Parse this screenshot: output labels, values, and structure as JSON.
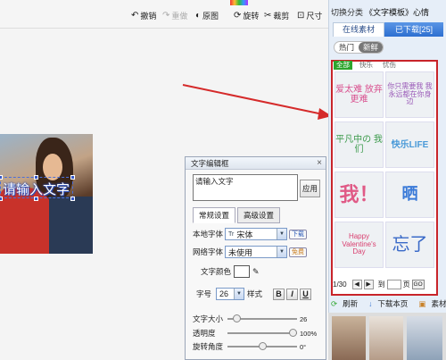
{
  "toolbar": {
    "undo": "撤销",
    "redo": "重做",
    "original": "原图",
    "rotate": "旋转",
    "crop": "裁剪",
    "size": "尺寸"
  },
  "canvas": {
    "text_preview": "请输入文字"
  },
  "right_panel": {
    "template_label": "切换分类",
    "template_value": "《文字模板》心情",
    "tab_online": "在线素材",
    "tab_downloaded": "已下载[25]",
    "sub_hot": "热门",
    "sub_new": "新鲜",
    "categories": [
      "全部",
      "快乐",
      "忧伤"
    ],
    "items": [
      {
        "text": "爱太难 放弃更难",
        "color": "#d9518f"
      },
      {
        "text": "你只需要我 我永远都在你身边",
        "color": "#9a5ab8"
      },
      {
        "text": "平凡中の 我们",
        "color": "#3a9a4a"
      },
      {
        "text": "快乐LIFE",
        "color": "#4a9ad8"
      },
      {
        "text": "我！",
        "color": "#e05a86"
      },
      {
        "text": "晒",
        "color": "#3a7ad8"
      },
      {
        "text": "Happy Valentine's Day",
        "color": "#d94070"
      },
      {
        "text": "忘了",
        "color": "#3a6ac8"
      }
    ],
    "pager": {
      "current": "1/30",
      "goto": "到",
      "page": "页",
      "go": "GO"
    },
    "bottom": {
      "refresh": "刷新",
      "download_page": "下载本页",
      "pack": "素材包"
    }
  },
  "dialog": {
    "title": "文字编辑框",
    "close": "×",
    "input_value": "请输入文字",
    "apply": "应用",
    "tab_normal": "常规设置",
    "tab_advanced": "高级设置",
    "local_font_label": "本地字体",
    "local_font_value": "宋体",
    "download_btn": "下载",
    "web_font_label": "网络字体",
    "web_font_value": "未使用",
    "free_btn": "免费",
    "color_label": "文字颜色",
    "size_label": "字号",
    "size_value": "26",
    "style_label": "样式",
    "bold": "B",
    "italic": "I",
    "underline": "U",
    "font_size_label": "文字大小",
    "font_size_value": "26",
    "opacity_label": "透明度",
    "opacity_value": "100%",
    "angle_label": "旋转角度",
    "angle_value": "0°"
  },
  "sliders": {
    "font_size": 0.08,
    "opacity": 1.0,
    "angle": 0.5
  },
  "colors": {
    "accent_blue": "#2d6fd0",
    "highlight_red": "#c8242a",
    "green": "#2ea52e"
  }
}
